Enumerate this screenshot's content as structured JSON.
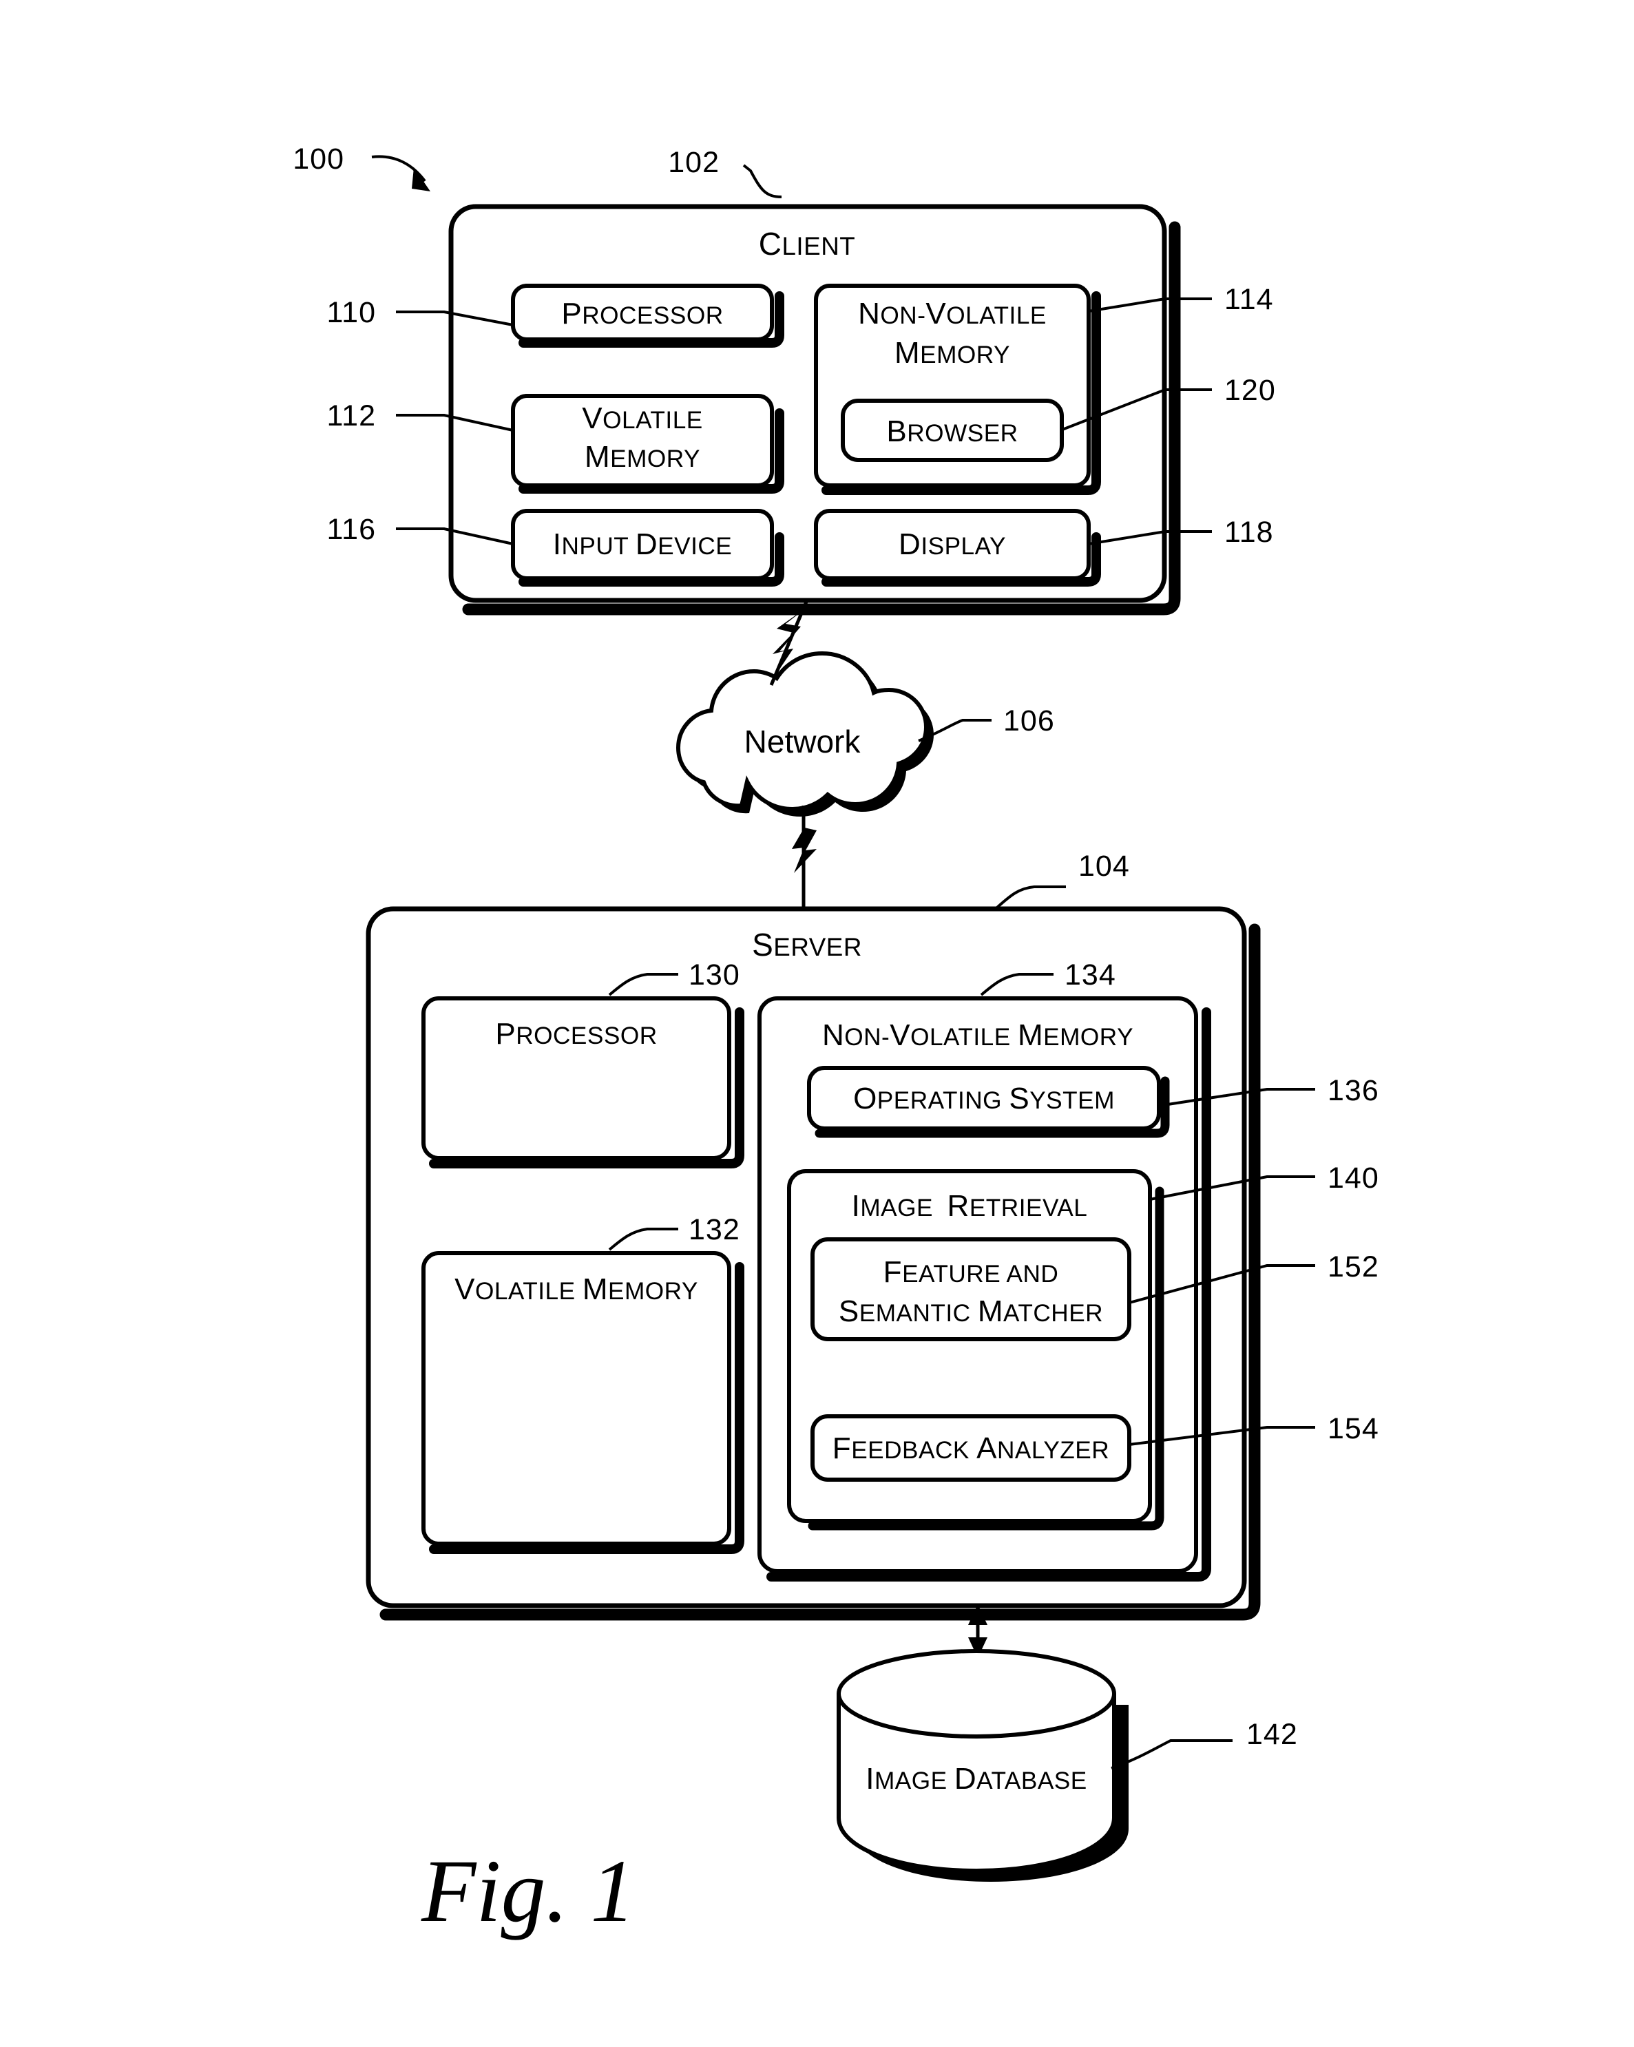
{
  "figure": {
    "caption": "Fig. 1",
    "system_ref": "100"
  },
  "client": {
    "title": "CLIENT",
    "ref": "102",
    "blocks": [
      {
        "label": "PROCESSOR",
        "ref": "110"
      },
      {
        "label": "VOLATILE MEMORY",
        "line1": "VOLATILE",
        "line2": "MEMORY",
        "ref": "112"
      },
      {
        "label": "INPUT DEVICE",
        "ref": "116"
      },
      {
        "label": "NON-VOLATILE MEMORY",
        "line1": "NON-VOLATILE",
        "line2": "MEMORY",
        "ref": "114"
      },
      {
        "label": "BROWSER",
        "ref": "120"
      },
      {
        "label": "DISPLAY",
        "ref": "118"
      }
    ]
  },
  "network": {
    "label": "Network",
    "ref": "106"
  },
  "server": {
    "title": "SERVER",
    "ref": "104",
    "blocks": [
      {
        "label": "PROCESSOR",
        "ref": "130"
      },
      {
        "label": "VOLATILE MEMORY",
        "ref": "132"
      },
      {
        "label": "NON-VOLATILE MEMORY",
        "ref": "134"
      },
      {
        "label": "OPERATING SYSTEM",
        "ref": "136"
      },
      {
        "label": "IMAGE  RETRIEVAL",
        "ref": "140"
      },
      {
        "label": "FEATURE AND SEMANTIC MATCHER",
        "line1": "FEATURE AND",
        "line2": "SEMANTIC MATCHER",
        "ref": "152"
      },
      {
        "label": "FEEDBACK ANALYZER",
        "ref": "154"
      }
    ]
  },
  "database": {
    "label": "IMAGE DATABASE",
    "ref": "142"
  }
}
